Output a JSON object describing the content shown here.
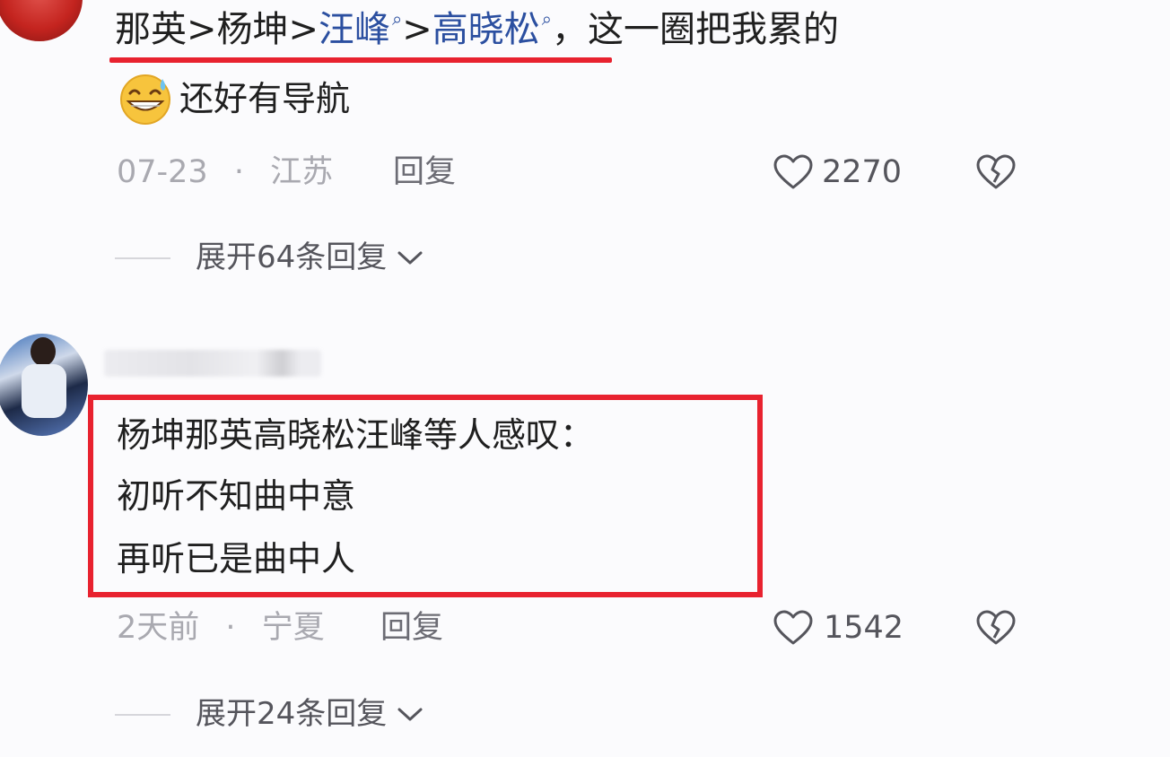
{
  "comments": [
    {
      "text_parts": {
        "p1": "那英>杨坤>",
        "link1": "汪峰",
        "sep": ">",
        "link2": "高晓松",
        "rest": "，这一圈把我累的"
      },
      "line2": "还好有导航",
      "emoji": "grinning-sweat-emoji",
      "meta": {
        "date": "07-23",
        "dot": "·",
        "location": "江苏"
      },
      "reply_label": "回复",
      "like_count": "2270",
      "expand_label": "展开64条回复"
    },
    {
      "username_blurred": true,
      "lines": [
        "杨坤那英高晓松汪峰等人感叹：",
        "初听不知曲中意",
        "再听已是曲中人"
      ],
      "meta": {
        "date": "2天前",
        "dot": "·",
        "location": "宁夏"
      },
      "reply_label": "回复",
      "like_count": "1542",
      "expand_label": "展开24条回复"
    }
  ],
  "colors": {
    "highlight_red": "#e8222f",
    "link_blue": "#2b4fa0",
    "muted": "#a9a9b0"
  }
}
